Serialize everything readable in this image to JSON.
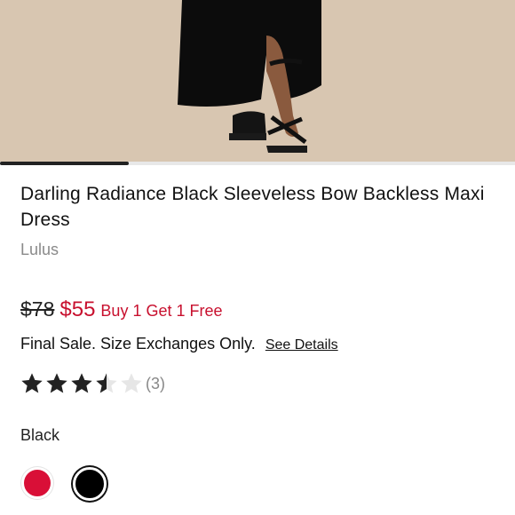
{
  "product": {
    "title": "Darling Radiance Black Sleeveless Bow Backless Maxi Dress",
    "brand": "Lulus",
    "original_price": "$78",
    "sale_price": "$55",
    "promo": "Buy 1 Get 1 Free",
    "final_sale_text": "Final Sale. Size Exchanges Only.",
    "see_details_label": "See Details",
    "rating_value": 3.5,
    "rating_max": 5,
    "rating_count_label": "(3)",
    "color_label": "Black",
    "colors": [
      {
        "name": "red",
        "hex": "#d90f37",
        "selected": false
      },
      {
        "name": "black",
        "hex": "#000000",
        "selected": true
      }
    ]
  },
  "gallery": {
    "progress": 0.25
  },
  "colors": {
    "sale_red": "#c8102e",
    "text_dark": "#111111",
    "muted_gray": "#8a8a8a",
    "star_fill": "#222222",
    "star_empty": "#e6e6e6"
  },
  "icons": {
    "star": "star-icon"
  }
}
